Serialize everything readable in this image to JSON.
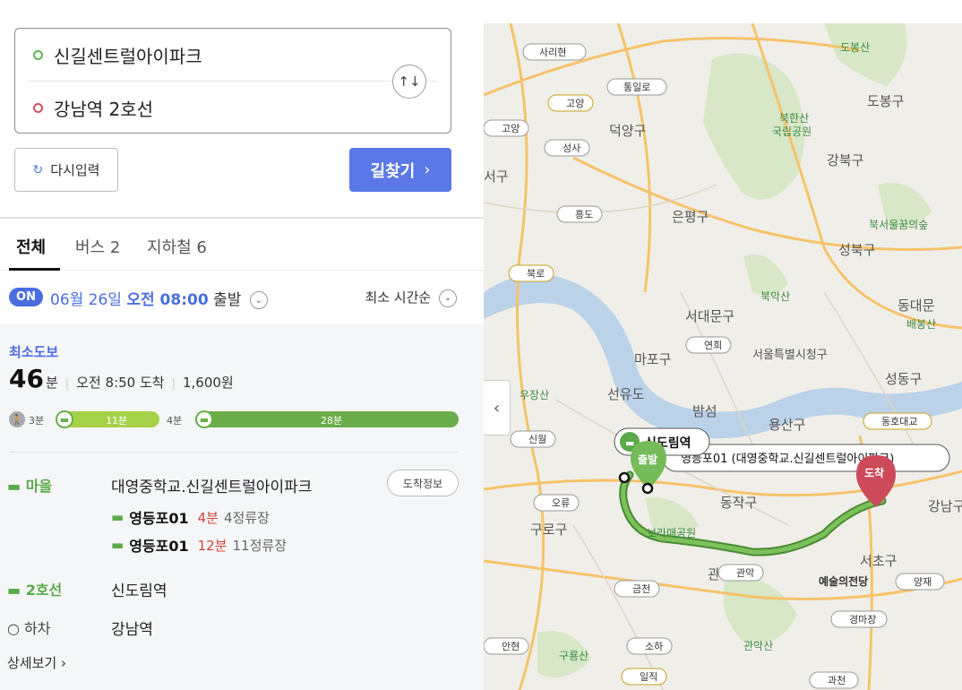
{
  "search": {
    "origin": "신길센트럴아이파크",
    "destination": "강남역 2호선",
    "swap_icon": "↑↓"
  },
  "actions": {
    "reset_label": "다시입력",
    "find_label": "길찾기",
    "find_chevron": "›"
  },
  "tabs": [
    {
      "label": "전체"
    },
    {
      "label": "버스 2"
    },
    {
      "label": "지하철 6"
    }
  ],
  "time": {
    "badge": "ON",
    "date": "06월 26일",
    "time": "오전 08:00",
    "suffix": "출발",
    "sort": "최소 시간순"
  },
  "route": {
    "label": "최소도보",
    "minutes": "46",
    "minutes_unit": "분",
    "arrival": "오전 8:50 도착",
    "fare": "1,600원",
    "timeline": {
      "walk1": "3분",
      "bus": "11분",
      "walk2": "4분",
      "subway": "28분"
    },
    "steps": {
      "bus_mode": "마을",
      "bus_stop": "대영중학교.신길센트럴아이파크",
      "arrival_info": "도착정보",
      "lines": [
        {
          "name": "영등포01",
          "minutes": "4분",
          "stops": "4정류장"
        },
        {
          "name": "영등포01",
          "minutes": "12분",
          "stops": "11정류장"
        }
      ],
      "subway_mode": "2호선",
      "subway_station": "신도림역",
      "alight_mode": "하차",
      "alight_station": "강남역"
    },
    "detail_link": "상세보기 ›"
  },
  "map": {
    "labels": {
      "dobongsan": "도봉산",
      "dobong_gu": "도봉구",
      "bukhansan": "북한산",
      "national_park": "국립공원",
      "gangbuk_gu": "강북구",
      "eunpyeong_gu": "은평구",
      "buksouul": "북서울꿈의숲",
      "seongbuk_gu": "성북구",
      "bukaksan": "북악산",
      "dongdaemun": "동대문",
      "baebongsan": "배봉산",
      "seodaemun_gu": "서대문구",
      "mapo_gu": "마포구",
      "seoul_city_hall": "서울특별시청구",
      "seongdong_gu": "성동구",
      "woojangsan": "우장산",
      "seonyudo": "선유도",
      "bamseom": "밤섬",
      "yongsan_gu": "용산구",
      "yeongdeungpo": "신월",
      "dongjak_gu": "동작구",
      "gangnam_gu": "강남구",
      "guro_gu": "구로구",
      "boramae": "보라매공원",
      "seocho_gu": "서초구",
      "arts_center": "예술의전당",
      "gwanak": "관",
      "gwanaksan": "관악산",
      "guryongsan": "구룡산",
      "deogyang_gu": "덕양구",
      "seo_gu": "서구"
    },
    "ic_labels": {
      "saritheyon": "사리현",
      "tongil": "통일로",
      "goyang_jc": "고양",
      "goyang_ic": "고양",
      "seongsa": "성사",
      "heungdo": "흥도",
      "bukro_jc": "북로",
      "yeonhui": "연희",
      "dongho": "동호대교",
      "sinwol": "신월",
      "oryu": "오류",
      "geumcheon": "금천",
      "gwanak_ic": "관악",
      "yangjae": "양재",
      "gyeongmajang": "경마장",
      "anhyeon": "안현",
      "soha": "소하",
      "iljik_jc": "일직",
      "gwacheon": "과천"
    },
    "markers": {
      "start": "출발",
      "end": "도착",
      "sindorim": "신도림역",
      "bus_callout": "영등포01 (대영중학교.신길센트럴아이파크)"
    },
    "route_color": "#6aad4a",
    "highway_color": "#f5c36b"
  },
  "icons": {
    "reset": "refresh-icon",
    "swap": "swap-icon",
    "bus": "bus-icon",
    "walk": "walk-icon",
    "subway": "subway-icon",
    "collapse": "chevron-left-icon"
  }
}
